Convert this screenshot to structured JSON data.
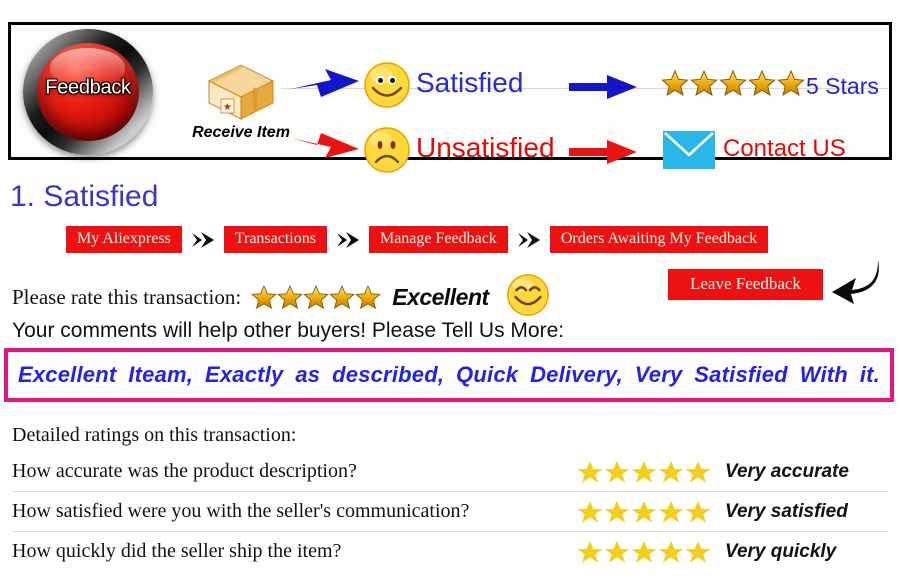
{
  "banner": {
    "feedback_button_label": "Feedback",
    "receive_item_label": "Receive Item",
    "satisfied_label": "Satisfied",
    "unsatisfied_label": "Unsatisfied",
    "five_stars_label": "5 Stars",
    "contact_label": "Contact US",
    "star_count": 5,
    "colors": {
      "button_red": "#ec1f13",
      "satisfied_blue": "#2a2ad0",
      "unsatisfied_red": "#e00b0b",
      "arrow_blue": "#1414c8",
      "arrow_red": "#e81414",
      "envelope_cyan": "#29b6e8",
      "gold_star": "#e8a712"
    },
    "icons": {
      "feedback": "feedback-button-icon",
      "package": "package-box-icon",
      "happy": "happy-face-icon",
      "sad": "sad-face-icon",
      "envelope": "envelope-icon",
      "arrow_blue": "blue-arrow-icon",
      "arrow_red": "red-arrow-icon"
    }
  },
  "section": {
    "title": "1. Satisfied"
  },
  "breadcrumb": {
    "separator": "➤",
    "items": [
      {
        "label": "My Aliexpress"
      },
      {
        "label": "Transactions"
      },
      {
        "label": "Manage Feedback"
      },
      {
        "label": "Orders Awaiting My Feedback"
      }
    ]
  },
  "rate": {
    "label": "Please rate this transaction:",
    "stars": 5,
    "verdict": "Excellent",
    "smiley": "happy-face-icon",
    "leave_feedback_label": "Leave Feedback",
    "arrow": "curved-arrow-icon"
  },
  "comments": {
    "prompt": "Your comments will help other buyers! Please Tell Us More:",
    "text": "Excellent Iteam, Exactly as described, Quick Delivery, Very Satisfied With it.",
    "border_color": "#e4157f",
    "text_color": "#2323e6"
  },
  "detailed_ratings": {
    "heading": "Detailed ratings on this transaction:",
    "star_color": "#f2cf1e",
    "rows": [
      {
        "question": "How accurate was the product description?",
        "stars": 5,
        "verdict": "Very accurate"
      },
      {
        "question": "How satisfied were you with the seller's communication?",
        "stars": 5,
        "verdict": "Very satisfied"
      },
      {
        "question": "How quickly did the seller ship the item?",
        "stars": 5,
        "verdict": "Very quickly"
      }
    ]
  }
}
